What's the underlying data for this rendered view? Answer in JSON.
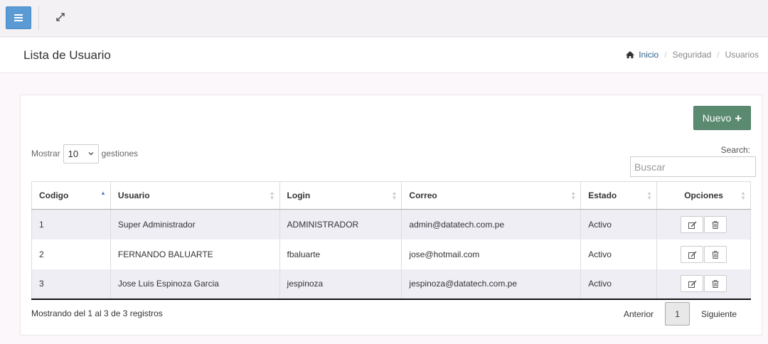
{
  "topbar": {
    "menu_icon": "hamburger-icon",
    "expand_icon": "expand-icon"
  },
  "header": {
    "title": "Lista de Usuario",
    "breadcrumb": {
      "home": "Inicio",
      "section": "Seguridad",
      "current": "Usuarios"
    }
  },
  "toolbar": {
    "new_label": "Nuevo"
  },
  "length": {
    "prefix": "Mostrar",
    "value": "10",
    "suffix": "gestiones"
  },
  "search": {
    "label": "Search:",
    "placeholder": "Buscar"
  },
  "table": {
    "columns": [
      "Codigo",
      "Usuario",
      "Login",
      "Correo",
      "Estado",
      "Opciones"
    ],
    "rows": [
      {
        "codigo": "1",
        "usuario": "Super Administrador",
        "login": "ADMINISTRADOR",
        "correo": "admin@datatech.com.pe",
        "estado": "Activo"
      },
      {
        "codigo": "2",
        "usuario": "FERNANDO BALUARTE",
        "login": "fbaluarte",
        "correo": "jose@hotmail.com",
        "estado": "Activo"
      },
      {
        "codigo": "3",
        "usuario": "Jose Luis Espinoza Garcia",
        "login": "jespinoza",
        "correo": "jespinoza@datatech.com.pe",
        "estado": "Activo"
      }
    ]
  },
  "footer": {
    "info": "Mostrando del 1 al 3 de 3 registros",
    "prev": "Anterior",
    "page": "1",
    "next": "Siguiente"
  },
  "colors": {
    "primary": "#5b9bd5",
    "success": "#5a8a70",
    "stripe": "#f0eef5"
  }
}
